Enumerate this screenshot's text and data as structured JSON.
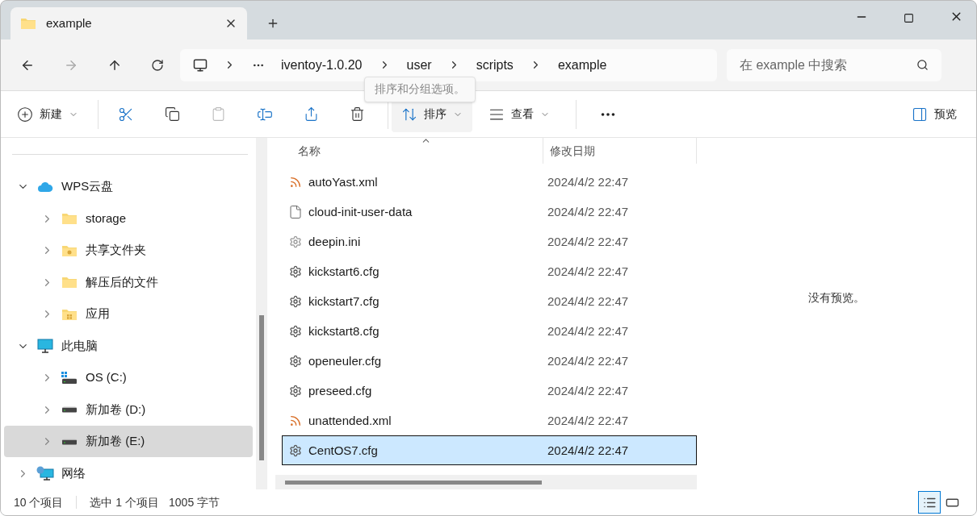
{
  "tabs": [
    {
      "label": "example",
      "selected": true
    }
  ],
  "breadcrumb": [
    "iventoy-1.0.20",
    "user",
    "scripts",
    "example"
  ],
  "tooltip": "排序和分组选项。",
  "search": {
    "placeholder": "在 example 中搜索"
  },
  "toolbar": {
    "new": "新建",
    "sort": "排序",
    "view": "查看",
    "preview": "预览"
  },
  "sidebar": [
    {
      "label": "WPS云盘",
      "kind": "cloud",
      "expanded": true,
      "selected": false,
      "children": [
        {
          "label": "storage",
          "kind": "folder",
          "expanded": false,
          "selected": false
        },
        {
          "label": "共享文件夹",
          "kind": "shared-folder",
          "expanded": false,
          "selected": false
        },
        {
          "label": "解压后的文件",
          "kind": "folder",
          "expanded": false,
          "selected": false
        },
        {
          "label": "应用",
          "kind": "app-folder",
          "expanded": false,
          "selected": false
        }
      ]
    },
    {
      "label": "此电脑",
      "kind": "pc",
      "expanded": true,
      "selected": false,
      "children": [
        {
          "label": "OS (C:)",
          "kind": "os-drive",
          "expanded": false,
          "selected": false
        },
        {
          "label": "新加卷 (D:)",
          "kind": "drive",
          "expanded": false,
          "selected": false
        },
        {
          "label": "新加卷 (E:)",
          "kind": "drive",
          "expanded": false,
          "selected": true
        }
      ]
    },
    {
      "label": "网络",
      "kind": "network",
      "expanded": false,
      "selected": false
    }
  ],
  "columns": [
    "名称",
    "修改日期"
  ],
  "files": [
    {
      "name": "autoYast.xml",
      "date": "2024/4/2 22:47",
      "kind": "xml",
      "selected": false
    },
    {
      "name": "cloud-init-user-data",
      "date": "2024/4/2 22:47",
      "kind": "blank",
      "selected": false
    },
    {
      "name": "deepin.ini",
      "date": "2024/4/2 22:47",
      "kind": "ini",
      "selected": false
    },
    {
      "name": "kickstart6.cfg",
      "date": "2024/4/2 22:47",
      "kind": "cfg",
      "selected": false
    },
    {
      "name": "kickstart7.cfg",
      "date": "2024/4/2 22:47",
      "kind": "cfg",
      "selected": false
    },
    {
      "name": "kickstart8.cfg",
      "date": "2024/4/2 22:47",
      "kind": "cfg",
      "selected": false
    },
    {
      "name": "openeuler.cfg",
      "date": "2024/4/2 22:47",
      "kind": "cfg",
      "selected": false
    },
    {
      "name": "preseed.cfg",
      "date": "2024/4/2 22:47",
      "kind": "cfg",
      "selected": false
    },
    {
      "name": "unattended.xml",
      "date": "2024/4/2 22:47",
      "kind": "xml",
      "selected": false
    },
    {
      "name": "CentOS7.cfg",
      "date": "2024/4/2 22:47",
      "kind": "cfg",
      "selected": true
    }
  ],
  "preview_message": "没有预览。",
  "status": [
    "10 个项目",
    "选中 1 个项目",
    "1005 字节"
  ],
  "view_modes": [
    {
      "kind": "details",
      "selected": true
    },
    {
      "kind": "tiles",
      "selected": false
    }
  ]
}
